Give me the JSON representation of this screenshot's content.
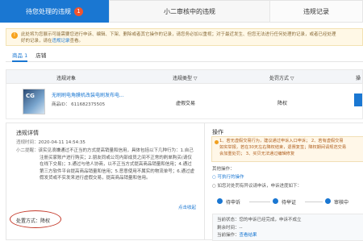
{
  "tabs": [
    {
      "label": "待您处理的违规",
      "badge": "1"
    },
    {
      "label": "小二审核中的违规"
    },
    {
      "label": "违规记录"
    }
  ],
  "notice": {
    "text": "此处将为您展示可能需要您进行申诉、编辑、下架、删除或者其它操作的记录，请您务必加以重视；对于最近发生、但您无法进行任何处理的记录，或者已经处理",
    "text2": "好的记录，请在",
    "link": "违规记录",
    "text3": "查看。"
  },
  "subtabs": [
    {
      "label": "商品 1"
    },
    {
      "label": "店铺"
    }
  ],
  "table": {
    "headers": {
      "object": "违规对象",
      "type": "违规类型 ▽",
      "method": "处罚方式 ▽",
      "action": "操"
    },
    "row": {
      "product_name": "无刷刷电角膜机改装电刷发布电...",
      "product_id": "商品ID： 611682375505",
      "type": "虚假交易",
      "method": "降权",
      "thumb_text": "CG"
    }
  },
  "detail": {
    "title": "违规详情",
    "time_label": "违规时间：",
    "time": "2020-04-11 14:54:35",
    "reason_label": "小二提醒：",
    "reason": "该实见浪嫌通过不正当的方式提高销量和信用，具体包括以下几种行为：1.自己注册买家账户进行购买；2.朋友同或公司内部成员之间不正常的刷单购买(请仅在线下交易)；3.通过与他人协商，以不正当方式提高商品销量和信用；4.通过第三方软件平台提高商品销量和信用；5.恶意使用不属实的物流单号；6.通过虚假发货或不实发来进行虚假交易，提高商品销量和信用。",
    "collapse": "点击收起",
    "method_label": "处置方式：",
    "method": "降权"
  },
  "ops": {
    "title": "操作",
    "note_line1": "1、若无虚假交易行为，建议通过申诉入口申诉；  2、若有虚假交易",
    "note_line2": "如实举报，若在30天左右降权结束，退赛复签；降权期间请规范交易",
    "note_line3": "会加重处罚；  3、买贝无法通过编辑修复",
    "other_title": "其他操作：",
    "other1": "○ 可执行的操作",
    "other2": "○ 如您对处罚有异议请申诉，申诉进度如下：",
    "steps": [
      "待申诉",
      "待举证",
      "审核中"
    ],
    "status_label": "当前状态：",
    "status": "您的申诉已经完成，申诉不成立",
    "remaining_label": "剩余时间：",
    "remaining": "--",
    "op_label": "当前操作：",
    "op_link": "查看结果"
  },
  "colors": {
    "accent": "#1a77d2",
    "badge": "#f2542d",
    "highlight_circle": "#c4392a"
  }
}
